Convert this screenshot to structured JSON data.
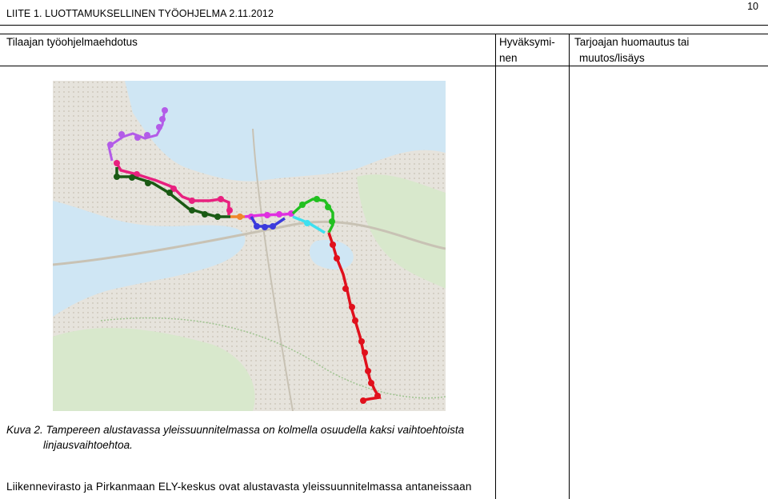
{
  "header": {
    "title": "LIITE 1.  LUOTTAMUKSELLINEN TYÖOHJELMA 2.11.2012",
    "page_number": "10"
  },
  "table": {
    "col1_header": "Tilaajan työohjelmaehdotus",
    "col2_header_line1": "Hyväksymi-",
    "col2_header_line2": "nen",
    "col3_header_line1": "Tarjoajan huomautus tai",
    "col3_header_line2": "muutos/lisäys"
  },
  "figure": {
    "caption_line1": "Kuva 2. Tampereen alustavassa yleissuunnitelmassa on kolmella osuudella kaksi vaihtoehtoista",
    "caption_line2": "linjausvaihtoehtoa.",
    "route_colors": {
      "purple": "#b35ce8",
      "pink": "#e8207f",
      "dark_green": "#1a5a14",
      "orange": "#f0862a",
      "magenta": "#e030e0",
      "blue": "#3b3bdc",
      "bright_green": "#22c020",
      "cyan": "#3ee0f0",
      "red": "#e0101c"
    }
  },
  "body": {
    "paragraph_start": "Liikennevirasto ja Pirkanmaan ELY-keskus ovat alustavasta yleissuunnitelmassa antaneissaan"
  }
}
